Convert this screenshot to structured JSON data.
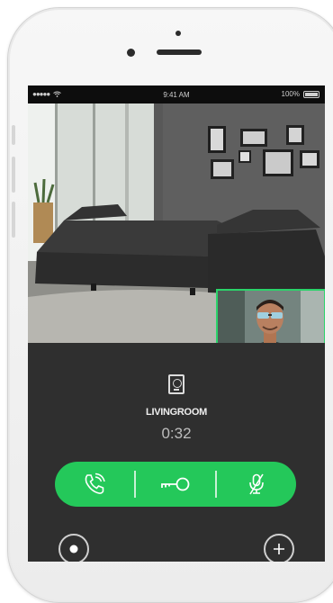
{
  "status_bar": {
    "signal": "●●●●●",
    "time": "9:41 AM",
    "battery": "100%"
  },
  "call": {
    "room_name": "LIVINGROOM",
    "timer": "0:32"
  },
  "actions": {
    "answer_icon": "phone-video-icon",
    "unlock_icon": "key-icon",
    "mute_icon": "microphone-muted-icon",
    "accent_color": "#24c85a"
  },
  "bottom_controls": {
    "left_icon": "record-icon",
    "right_icon": "plus-icon"
  }
}
